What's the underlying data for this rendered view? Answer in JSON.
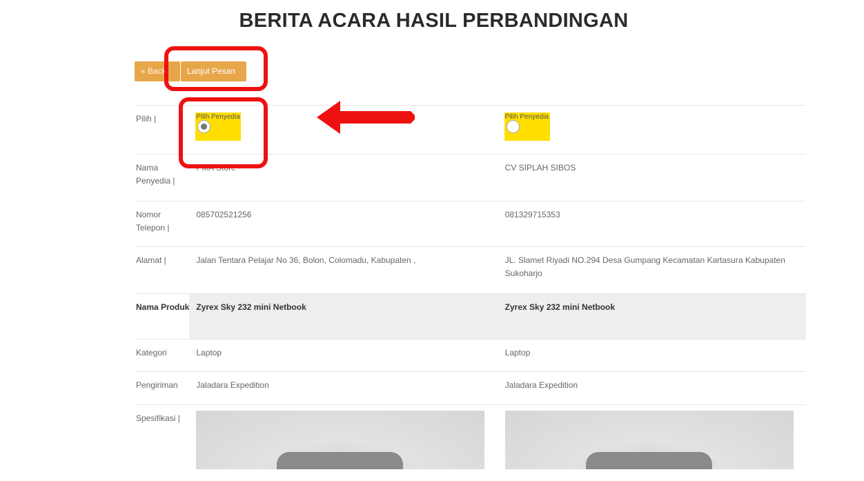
{
  "page_title": "BERITA ACARA HASIL PERBANDINGAN",
  "toolbar": {
    "back_label": "« Back",
    "next_label": "Lanjut Pesan",
    "button_color": "#e8a64b"
  },
  "table": {
    "labels": {
      "pilih": "Pilih |",
      "nama": "Nama Penyedia |",
      "nomor": "Nomor Telepon |",
      "alamat": "Alamat |",
      "produk": "Nama Produk",
      "kategori": "Kategori",
      "pengiriman": "Pengiriman",
      "spesifikasi": "Spesifikasi |"
    },
    "vendors": [
      {
        "pilih_label": "Pilih Penyedia",
        "selected": true,
        "nama": "PMA Store",
        "nomor": "085702521256",
        "alamat": "Jalan Tentara Pelajar No 36, Bolon, Colomadu, Kabupaten ,",
        "produk": "Zyrex Sky 232 mini Netbook",
        "kategori": "Laptop",
        "pengiriman": "Jaladara Expedition"
      },
      {
        "pilih_label": "Pilih Penyedia",
        "selected": false,
        "nama": "CV SIPLAH SIBOS",
        "nomor": "081329715353",
        "alamat": "JL. Slamet Riyadi NO.294 Desa Gumpang Kecamatan Kartasura Kabupaten Sukoharjo",
        "produk": "Zyrex Sky 232 mini Netbook",
        "kategori": "Laptop",
        "pengiriman": "Jaladara Expedition"
      }
    ]
  },
  "colors": {
    "highlight_yellow": "#ffde00",
    "annotation_red": "#ee1111"
  }
}
